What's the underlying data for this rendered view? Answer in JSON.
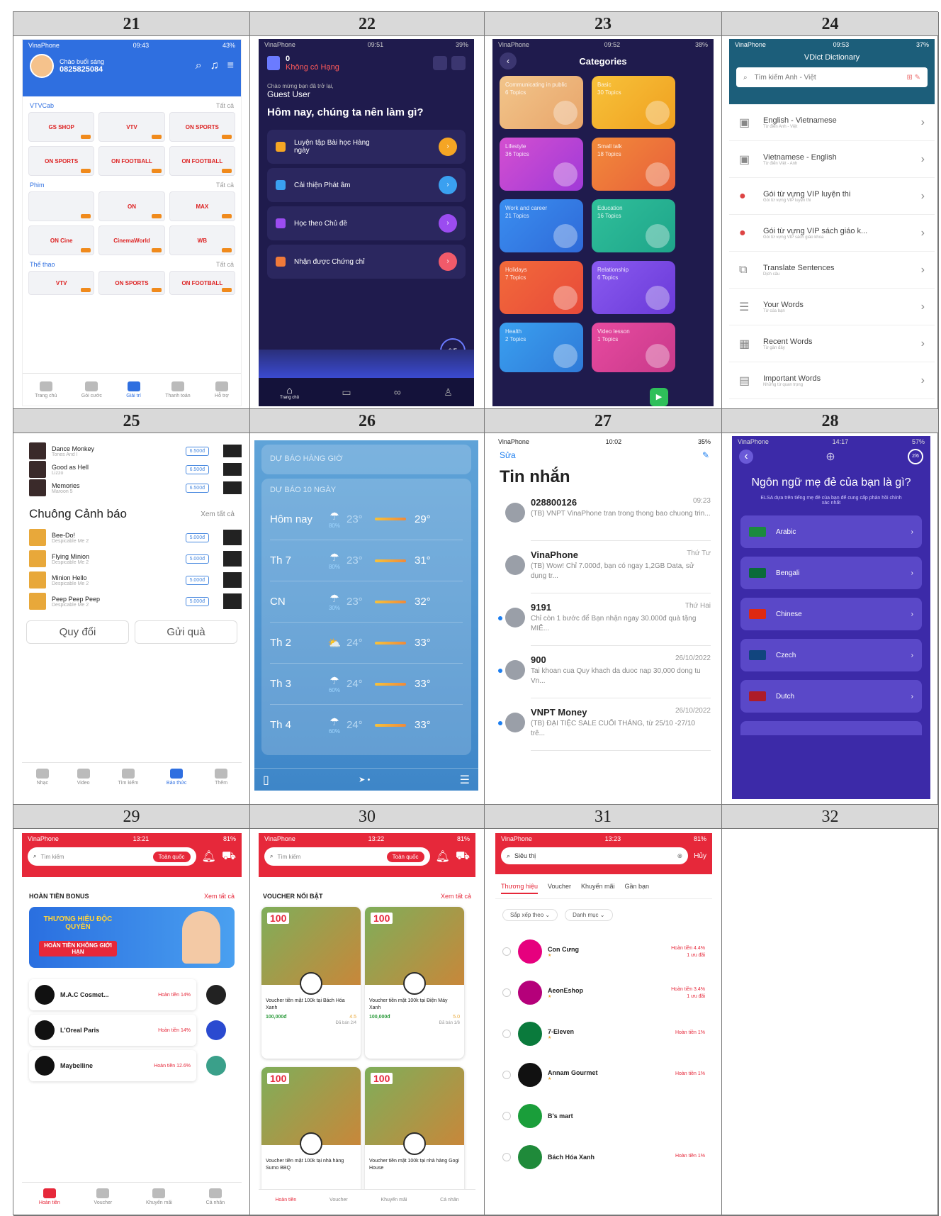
{
  "headers": [
    "21",
    "22",
    "23",
    "24",
    "25",
    "26",
    "27",
    "28",
    "29",
    "30",
    "31",
    "32"
  ],
  "p21": {
    "status": {
      "carrier": "VinaPhone",
      "time": "09:43",
      "batt": "43%"
    },
    "greeting": "Chào buổi sáng",
    "phone": "0825825084",
    "sections": [
      {
        "title": "VTVCab",
        "more": "Tất cả"
      },
      {
        "title": "Phim",
        "more": "Tất cả"
      },
      {
        "title": "Thể thao",
        "more": "Tất cả"
      }
    ],
    "tiles": [
      "GS SHOP",
      "VTV",
      "ON SPORTS",
      "ON SPORTS",
      "ON FOOTBALL",
      "ON FOOTBALL"
    ],
    "tiles2": [
      "",
      "ON",
      "MAX",
      "ON Cine",
      "CinemaWorld",
      "WB"
    ],
    "tabs": [
      "Trang chủ",
      "Gói cước",
      "Giải trí",
      "Thanh toán",
      "Hỗ trợ"
    ]
  },
  "p22": {
    "score": "0",
    "rank": "Không có Hạng",
    "welcome": "Chào mừng bạn đã trở lại,",
    "user": "Guest User",
    "question": "Hôm nay, chúng ta nên làm gì?",
    "items": [
      "Luyện tập Bài học Hàng ngày",
      "Cải thiện Phát âm",
      "Học theo Chủ đề",
      "Nhận được Chứng chỉ"
    ],
    "progress": "0/5",
    "tab": "Trang chủ"
  },
  "p23": {
    "title": "Categories",
    "cards": [
      {
        "name": "Communicating in public",
        "topics": "6 Topics"
      },
      {
        "name": "Basic",
        "topics": "30 Topics"
      },
      {
        "name": "Lifestyle",
        "topics": "36 Topics"
      },
      {
        "name": "Small talk",
        "topics": "18 Topics"
      },
      {
        "name": "Work and career",
        "topics": "21 Topics"
      },
      {
        "name": "Education",
        "topics": "16 Topics"
      },
      {
        "name": "Holidays",
        "topics": "7 Topics"
      },
      {
        "name": "Relationship",
        "topics": "6 Topics"
      },
      {
        "name": "Health",
        "topics": "2 Topics"
      },
      {
        "name": "Video lesson",
        "topics": "1 Topics"
      }
    ]
  },
  "p24": {
    "title": "VDict Dictionary",
    "search": "Tìm kiếm Anh - Việt",
    "items": [
      {
        "t": "English - Vietnamese",
        "s": "Từ điển Anh - Việt"
      },
      {
        "t": "Vietnamese - English",
        "s": "Từ điển Việt - Anh"
      },
      {
        "t": "Gói từ vựng VIP luyện thi",
        "s": "Gói từ vựng VIP luyện thi"
      },
      {
        "t": "Gói từ vựng VIP sách giáo k...",
        "s": "Gói từ vựng VIP sách giáo khoa"
      },
      {
        "t": "Translate Sentences",
        "s": "Dịch câu"
      },
      {
        "t": "Your Words",
        "s": "Từ của bạn"
      },
      {
        "t": "Recent Words",
        "s": "Từ gần đây"
      },
      {
        "t": "Important Words",
        "s": "Những từ quan trọng"
      }
    ]
  },
  "p25": {
    "songs": [
      {
        "t": "Dance Monkey",
        "a": "Tones And I",
        "p": "6.500đ"
      },
      {
        "t": "Good as Hell",
        "a": "Lizzo",
        "p": "6.500đ"
      },
      {
        "t": "Memories",
        "a": "Maroon 5",
        "p": "6.500đ"
      }
    ],
    "section": "Chuông Cảnh báo",
    "more": "Xem tất cả",
    "alarms": [
      {
        "t": "Bee-Do!",
        "a": "Despicable Me 2",
        "p": "5.000đ"
      },
      {
        "t": "Flying Minion",
        "a": "Despicable Me 2",
        "p": "5.000đ"
      },
      {
        "t": "Minion Hello",
        "a": "Despicable Me 2",
        "p": "5.000đ"
      },
      {
        "t": "Peep Peep Peep",
        "a": "Despicable Me 2",
        "p": "5.000đ"
      }
    ],
    "btn1": "Quy đổi",
    "btn2": "Gửi quà",
    "tabs": [
      "Nhạc",
      "Video",
      "Tìm kiếm",
      "Báo thức",
      "Thêm"
    ]
  },
  "p26": {
    "hourly": "DỰ BÁO HÀNG GIỜ",
    "daily": "DỰ BÁO 10 NGÀY",
    "days": [
      {
        "d": "Hôm nay",
        "p": "80%",
        "lo": "23°",
        "hi": "29°"
      },
      {
        "d": "Th 7",
        "p": "80%",
        "lo": "23°",
        "hi": "31°"
      },
      {
        "d": "CN",
        "p": "30%",
        "lo": "23°",
        "hi": "32°"
      },
      {
        "d": "Th 2",
        "p": "",
        "lo": "24°",
        "hi": "33°"
      },
      {
        "d": "Th 3",
        "p": "60%",
        "lo": "24°",
        "hi": "33°"
      },
      {
        "d": "Th 4",
        "p": "60%",
        "lo": "24°",
        "hi": "33°"
      }
    ]
  },
  "p27": {
    "edit": "Sửa",
    "title": "Tin nhắn",
    "msgs": [
      {
        "n": "028800126",
        "t": "09:23",
        "b": "(TB) VNPT VinaPhone tran trong thong bao chuong trin..."
      },
      {
        "n": "VinaPhone",
        "t": "Thứ Tư",
        "b": "(TB) Wow! Chỉ 7.000đ, bạn có ngay 1,2GB Data, sử dụng tr..."
      },
      {
        "n": "9191",
        "t": "Thứ Hai",
        "b": "Chỉ còn 1 bước để Bạn nhận ngay 30.000đ quà tặng MIỄ..."
      },
      {
        "n": "900",
        "t": "26/10/2022",
        "b": "Tai khoan cua Quy khach da duoc nap 30,000 dong tu Vn..."
      },
      {
        "n": "VNPT Money",
        "t": "26/10/2022",
        "b": "(TB) ĐẠI TIỆC SALE CUỐI THÁNG, từ 25/10 -27/10 trê..."
      }
    ]
  },
  "p28": {
    "step": "2/6",
    "q": "Ngôn ngữ mẹ đẻ của bạn là gì?",
    "sub": "ELSA dựa trên tiếng mẹ đẻ của bạn để cung cấp phản hồi chính xác nhất",
    "langs": [
      "Arabic",
      "Bengali",
      "Chinese",
      "Czech",
      "Dutch"
    ],
    "flags": [
      "#1b8a3e",
      "#0a6b3a",
      "#de2910",
      "#11457e",
      "#ae1c28"
    ]
  },
  "p29": {
    "search": "Tìm kiếm",
    "region": "Toàn quốc",
    "section": "HOÀN TIỀN BONUS",
    "more": "Xem tất cả",
    "banner1": "THƯƠNG HIỆU ĐỘC QUYỀN",
    "banner2": "HOÀN TIỀN KHÔNG GIỚI HẠN",
    "brands": [
      {
        "n": "M.A.C Cosmet...",
        "c": "Hoàn tiền 14%"
      },
      {
        "n": "L'Oreal Paris",
        "c": "Hoàn tiền 14%"
      },
      {
        "n": "Maybelline",
        "c": "Hoàn tiền 12.6%"
      }
    ],
    "tabs": [
      "Hoàn tiền",
      "Voucher",
      "Khuyến mãi",
      "Cá nhân"
    ]
  },
  "p30": {
    "search": "Tìm kiếm",
    "region": "Toàn quốc",
    "section": "VOUCHER NỔI BẬT",
    "more": "Xem tất cả",
    "vouchers": [
      {
        "t": "Voucher tiền mặt 100k tại Bách Hóa Xanh",
        "p": "100,000đ",
        "r": "4.5",
        "sold": "Đã bán 2/4"
      },
      {
        "t": "Voucher tiền mặt 100k tại Điện Máy Xanh",
        "p": "100,000đ",
        "r": "5.0",
        "sold": "Đã bán 1/6"
      },
      {
        "t": "Voucher tiền mặt 100k tại nhà hàng Sumo BBQ",
        "p": "",
        "r": "",
        "sold": ""
      },
      {
        "t": "Voucher tiền mặt 100k tại nhà hàng Gogi House",
        "p": "",
        "r": "",
        "sold": ""
      }
    ],
    "tabs": [
      "Hoàn tiền",
      "Voucher",
      "Khuyến mãi",
      "Cá nhân"
    ]
  },
  "p31": {
    "search": "Siêu thị",
    "cancel": "Hủy",
    "tabs": [
      "Thương hiệu",
      "Voucher",
      "Khuyến mãi",
      "Gần bạn"
    ],
    "sort": "Sắp xếp theo",
    "cat": "Danh mục",
    "stores": [
      {
        "n": "Con Cưng",
        "c": "Hoàn tiền 4.4%",
        "v": "1 ưu đãi",
        "col": "#e6007e"
      },
      {
        "n": "AeonEshop",
        "c": "Hoàn tiền 3.4%",
        "v": "1 ưu đãi",
        "col": "#b5007a"
      },
      {
        "n": "7-Eleven",
        "c": "Hoàn tiền 1%",
        "v": "",
        "col": "#0a7a3c"
      },
      {
        "n": "Annam Gourmet",
        "c": "Hoàn tiền 1%",
        "v": "",
        "col": "#111"
      },
      {
        "n": "B's mart",
        "c": "",
        "v": "",
        "col": "#1a9e3a"
      },
      {
        "n": "Bách Hóa Xanh",
        "c": "Hoàn tiền 1%",
        "v": "",
        "col": "#1f8a3a"
      }
    ]
  }
}
